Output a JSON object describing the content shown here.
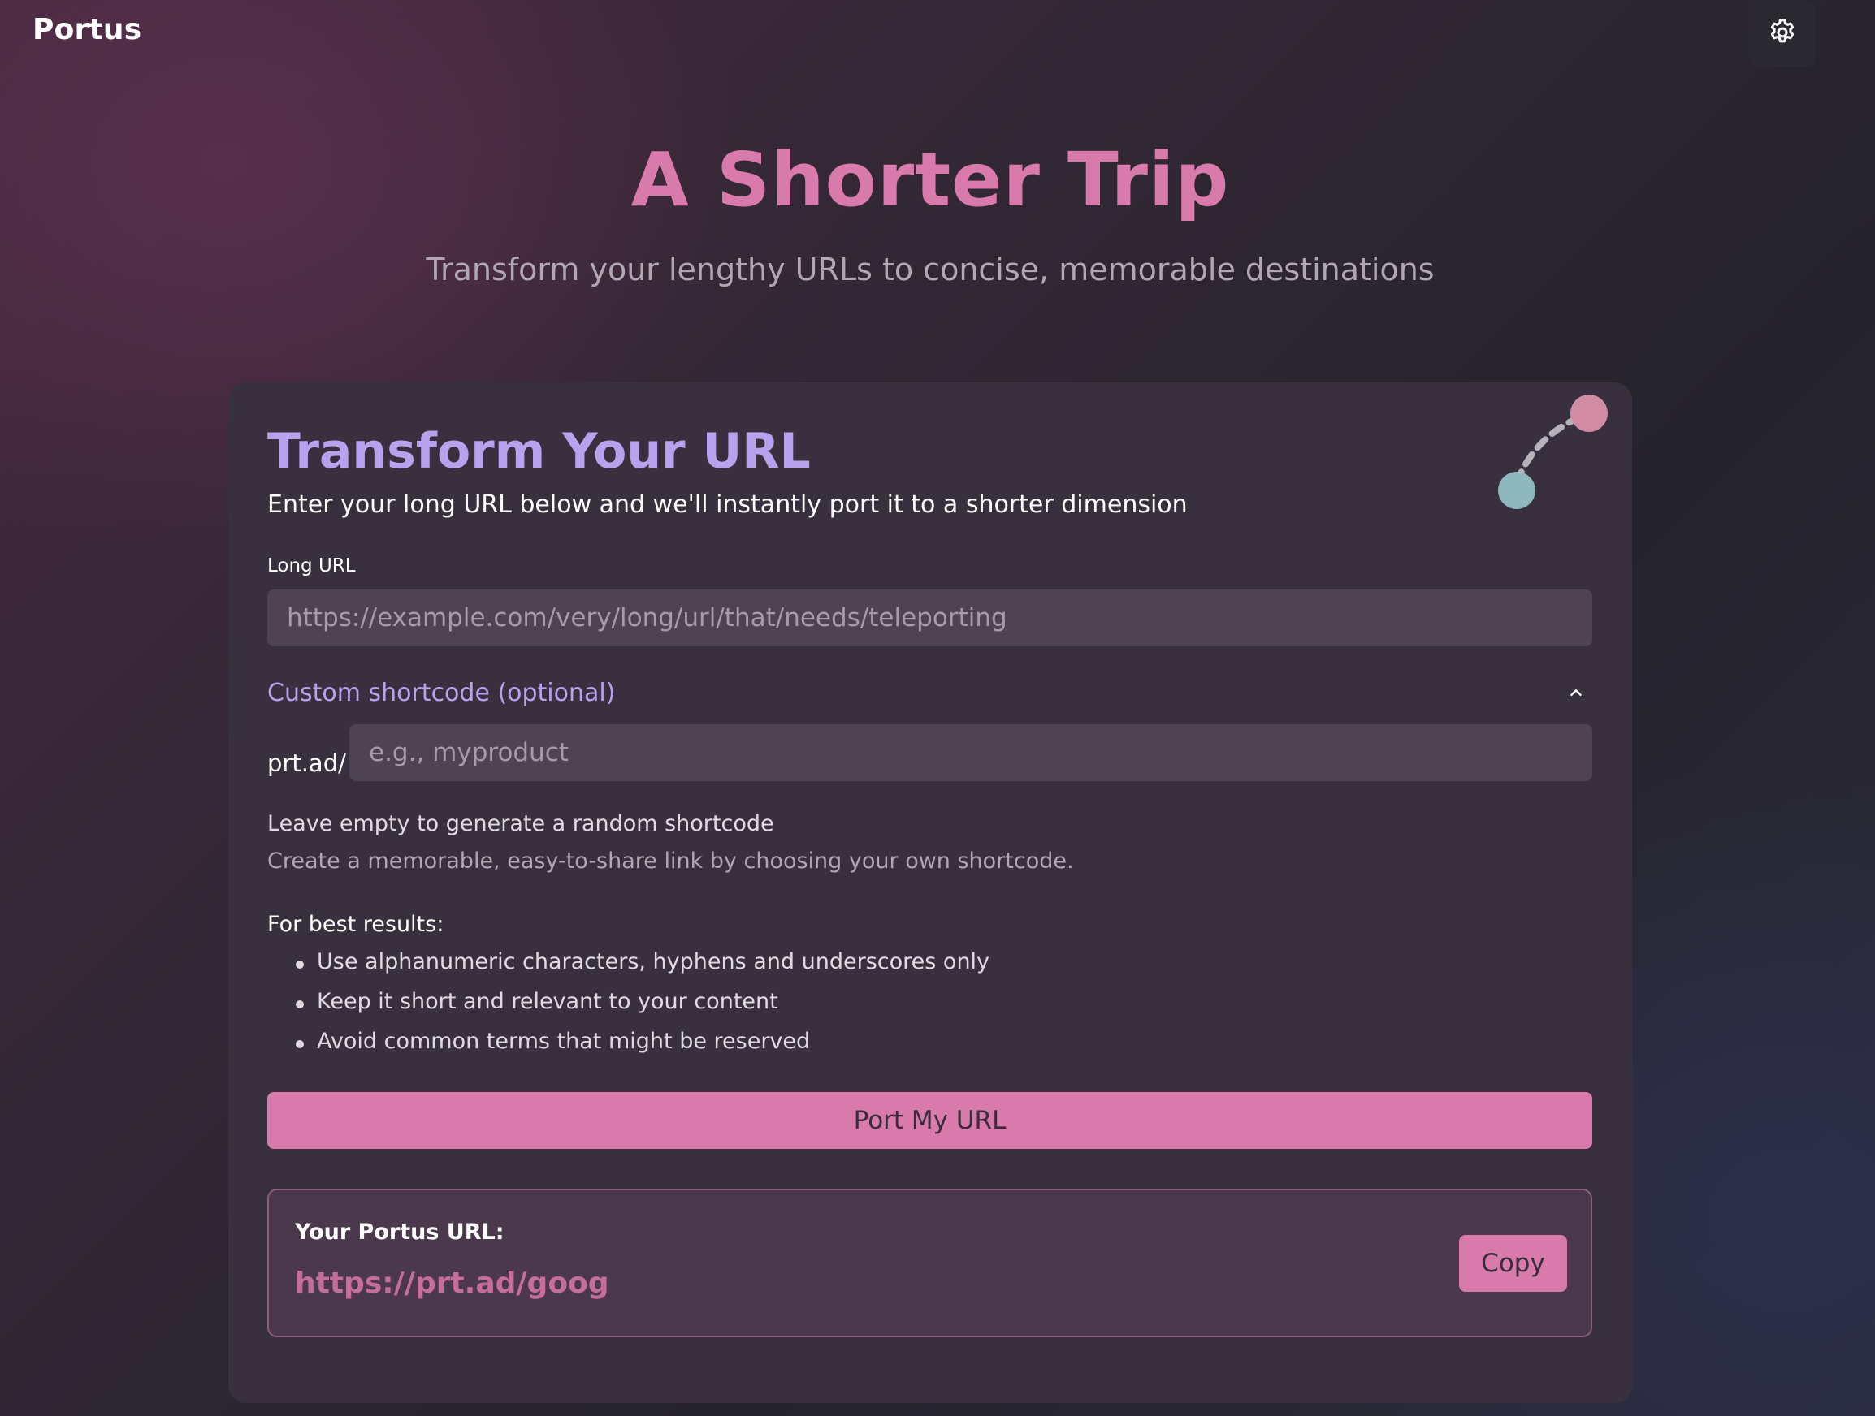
{
  "header": {
    "brand": "Portus",
    "settings_icon": "gear-icon"
  },
  "hero": {
    "title": "A Shorter Trip",
    "subtitle": "Transform your lengthy URLs to concise, memorable destinations"
  },
  "form": {
    "title": "Transform Your URL",
    "description": "Enter your long URL below and we'll instantly port it to a shorter dimension",
    "decor_icon": "portal-link-icon",
    "long_url": {
      "label": "Long URL",
      "value": "",
      "placeholder": "https://example.com/very/long/url/that/needs/teleporting"
    },
    "custom": {
      "toggle_label": "Custom shortcode (optional)",
      "toggle_icon": "chevron-up-icon",
      "expanded": true,
      "prefix": "prt.ad/",
      "value": "",
      "placeholder": "e.g., myproduct",
      "hint": "Leave empty to generate a random shortcode",
      "hint_secondary": "Create a memorable, easy-to-share link by choosing your own shortcode.",
      "tips_title": "For best results:",
      "tips": [
        "Use alphanumeric characters, hyphens and underscores only",
        "Keep it short and relevant to your content",
        "Avoid common terms that might be reserved"
      ]
    },
    "submit_label": "Port My URL"
  },
  "result": {
    "label": "Your Portus URL:",
    "url": "https://prt.ad/goog",
    "copy_label": "Copy"
  },
  "colors": {
    "accent_pink": "#d97aac",
    "accent_purple": "#b8a2ee",
    "card_bg": "#38303e",
    "input_bg": "#4e4253",
    "portal_pink": "#d18ba3",
    "portal_teal": "#8fb8be"
  }
}
